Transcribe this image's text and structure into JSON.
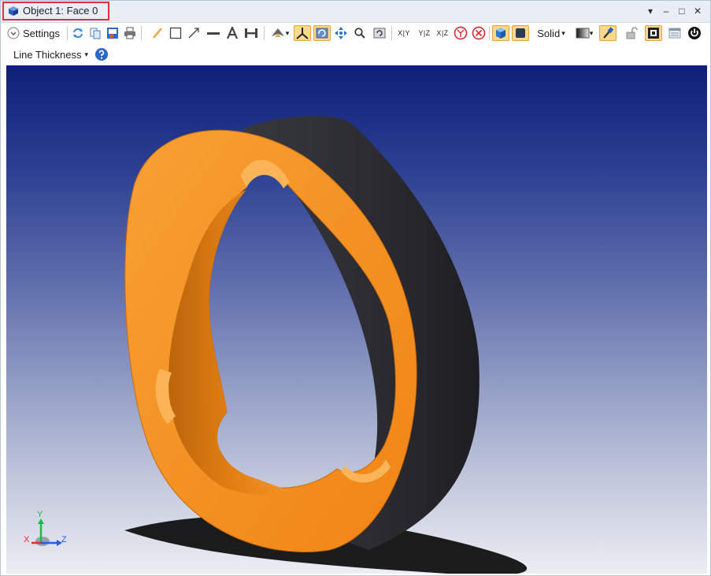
{
  "window": {
    "title": "Object 1: Face 0",
    "icon": "cube-icon",
    "controls": {
      "menu": "▾",
      "minimize": "–",
      "maximize": "□",
      "close": "✕"
    }
  },
  "toolbar": {
    "settings_label": "Settings",
    "shade_mode_label": "Solid",
    "line_thickness_label": "Line Thickness",
    "xy_label": "X|Y",
    "yz_label": "Y|Z",
    "xz_label": "X|Z",
    "dropdown_arrow": "▾"
  },
  "viewport": {
    "axis_labels": {
      "x": "X",
      "y": "Y",
      "z": "Z"
    },
    "colors": {
      "part_face": "#f7901e",
      "part_side": "#2a2a30",
      "bg_top": "#0f1f78",
      "bg_bottom": "#eceef3"
    }
  }
}
